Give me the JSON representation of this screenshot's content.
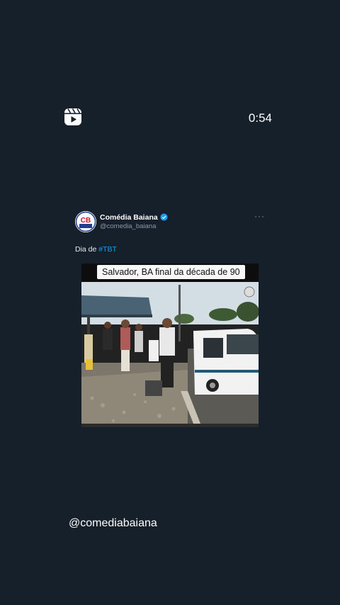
{
  "player": {
    "reels_icon": "reels-icon",
    "duration": "0:54"
  },
  "tweet": {
    "avatar_text": "CB",
    "avatar_subtext": "COMÉDIA BAIANA",
    "author": "Comédia Baiana",
    "handle": "@comedia_baiana",
    "verified_icon": "verified-check-icon",
    "more_icon": "more-dots-icon",
    "more_label": "···",
    "text_prefix": "Dia de ",
    "hashtag": "#TBT"
  },
  "media": {
    "caption": "Salvador, BA final da década de 90",
    "scene": "street-scene-photo"
  },
  "footer": {
    "handle": "@comediabaiana"
  },
  "colors": {
    "background": "#15202b",
    "link": "#1d9bf0",
    "verified": "#1d9bf0",
    "secondary_text": "#8b98a5"
  }
}
